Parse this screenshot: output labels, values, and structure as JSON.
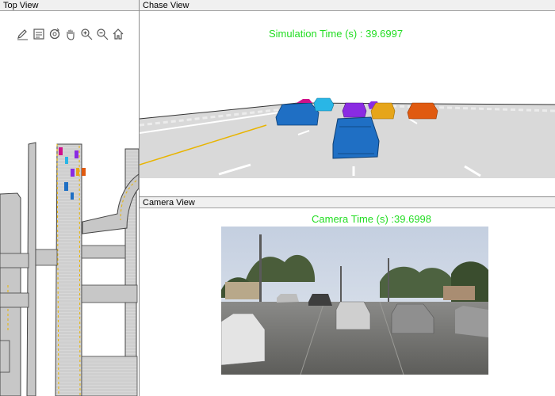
{
  "panels": {
    "top_view": {
      "title": "Top View"
    },
    "chase_view": {
      "title": "Chase View",
      "time_label": "Simulation Time (s) : 39.6997"
    },
    "camera_view": {
      "title": "Camera View",
      "time_label": "Camera Time (s) :39.6998"
    }
  },
  "toolbar": {
    "tools": [
      "edit-icon",
      "legend-icon",
      "rotate-icon",
      "pan-icon",
      "zoom-in-icon",
      "zoom-out-icon",
      "home-icon"
    ]
  },
  "colors": {
    "time_text": "#22dd22",
    "ego_vehicle": "#1f6fc4",
    "vehicle_purple": "#8a2be2",
    "vehicle_magenta": "#d0108a",
    "vehicle_cyan": "#29b6e6",
    "vehicle_yellow": "#e6a51a",
    "vehicle_orange": "#e05a10"
  }
}
